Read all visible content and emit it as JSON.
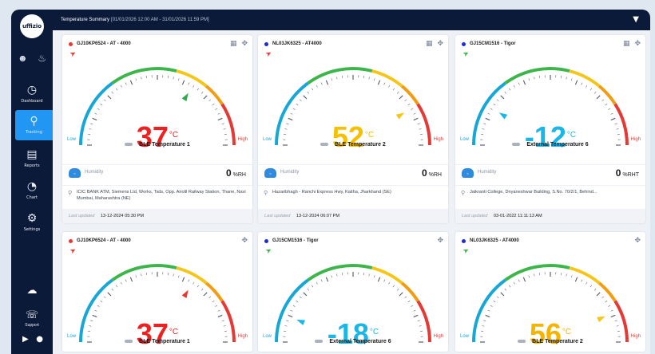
{
  "app": {
    "logo_text": "uffizio",
    "header_title": "Temperature Summary",
    "header_range": "[01/01/2026 12:00 AM - 31/01/2026 11:59 PM]",
    "icons": {
      "user": "user-icon",
      "bell": "bell-icon",
      "filter": "filter-icon",
      "upload": "cloud-upload-icon"
    }
  },
  "sidebar": {
    "items": [
      {
        "label": "Dashboard",
        "icon": "speedometer-icon",
        "active": false
      },
      {
        "label": "Tracking",
        "icon": "location-icon",
        "active": true
      },
      {
        "label": "Reports",
        "icon": "report-icon",
        "active": false
      },
      {
        "label": "Chart",
        "icon": "pie-chart-icon",
        "active": false
      },
      {
        "label": "Settings",
        "icon": "gear-icon",
        "active": false
      }
    ],
    "support_label": "Support"
  },
  "colors": {
    "low": "#17a7d6",
    "green": "#3cb54a",
    "yellow": "#f5c518",
    "orange": "#f39c12",
    "high": "#e53935",
    "sidebar_bg": "#0c1a3a",
    "active_nav": "#2196f3"
  },
  "gauge_min": -30,
  "gauge_max": 70,
  "cards": [
    {
      "vehicle": "GJ10KP6524 - AT - 4000",
      "status_color": "#e53935",
      "pin_color": "#e53935",
      "value": 37,
      "unit": "°C",
      "value_color": "#ef2020",
      "needle_color": "#2eaa4a",
      "low_label": "Low",
      "high_label": "High",
      "sensor": "BLE Temperature 1",
      "humidity_label": "Humidity",
      "humidity_value": "0",
      "humidity_unit": "%RH",
      "address": "ICIC BANK ATM, Siemens Ltd, Works, Tsds, Opp. Airolil Railway Station, Thane, Navi Mumbai, Maharashtra (NE)",
      "updated_label": "Last updated",
      "updated_time": "13-12-2024 05:30 PM"
    },
    {
      "vehicle": "NL03JK6325 - AT4000",
      "status_color": "#1e2ad6",
      "pin_color": "#e53935",
      "value": 52,
      "unit": "°C",
      "value_color": "#f5c000",
      "needle_color": "#f5c518",
      "low_label": "Low",
      "high_label": "High",
      "sensor": "BLE Temperature 2",
      "humidity_label": "Humidity",
      "humidity_value": "0",
      "humidity_unit": "%RH",
      "address": "Hazaribhagh - Ranchi Express Hwy, Kaitha, Jharkhand (SE)",
      "updated_label": "Last updated",
      "updated_time": "13-12-2024 06:07 PM"
    },
    {
      "vehicle": "GJ15CM1516 - Tigor",
      "status_color": "#1e2ad6",
      "pin_color": "#3cb54a",
      "value": -12,
      "unit": "°C",
      "value_color": "#19b6e8",
      "needle_color": "#19b6e8",
      "low_label": "Low",
      "high_label": "High",
      "sensor": "External Temperature 6",
      "humidity_label": "Humidity",
      "humidity_value": "0",
      "humidity_unit": "%RHT",
      "address": "Jaikranti College, Dnyaneshwar Building, S.No. 70/2/1, Behind...",
      "updated_label": "Last updated",
      "updated_time": "03-01-2022 11:11:13 AM"
    },
    {
      "vehicle": "GJ10KP6524 - AT - 4000",
      "status_color": "#e53935",
      "pin_color": "#e53935",
      "value": 37,
      "unit": "°C",
      "value_color": "#ef2020",
      "needle_color": "#e53935",
      "low_label": "Low",
      "high_label": "High",
      "sensor": "BLE Temperature 1"
    },
    {
      "vehicle": "GJ15CM1516 - Tigor",
      "status_color": "#1e2ad6",
      "pin_color": "#3cb54a",
      "value": -18,
      "unit": "°C",
      "value_color": "#19b6e8",
      "needle_color": "#19b6e8",
      "low_label": "Low",
      "high_label": "High",
      "sensor": "External Temperature 6"
    },
    {
      "vehicle": "NL03JK6325 - AT4000",
      "status_color": "#1e2ad6",
      "pin_color": "#3cb54a",
      "value": 56,
      "unit": "°C",
      "value_color": "#f5b400",
      "needle_color": "#f5c518",
      "low_label": "Low",
      "high_label": "High",
      "sensor": "BLE Temperature 2"
    }
  ]
}
